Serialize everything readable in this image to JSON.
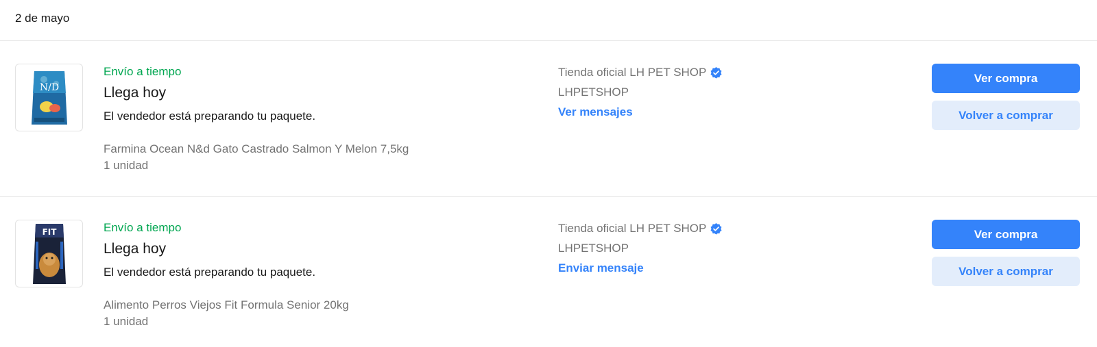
{
  "date_header": "2 de mayo",
  "colors": {
    "accent": "#3483fa",
    "success": "#00a650",
    "muted": "#737373",
    "secondary_bg": "#e3edfb"
  },
  "orders": [
    {
      "status": "Envío a tiempo",
      "headline": "Llega hoy",
      "description": "El vendedor está preparando tu paquete.",
      "product": "Farmina Ocean N&d Gato Castrado Salmon Y Melon 7,5kg",
      "quantity": "1 unidad",
      "seller_official": "Tienda oficial LH PET SHOP",
      "seller_nick": "LHPETSHOP",
      "seller_link": "Ver mensajes",
      "primary_button": "Ver compra",
      "secondary_button": "Volver a comprar",
      "thumb_icon": "cat-food-bag-icon"
    },
    {
      "status": "Envío a tiempo",
      "headline": "Llega hoy",
      "description": "El vendedor está preparando tu paquete.",
      "product": "Alimento Perros Viejos Fit Formula Senior 20kg",
      "quantity": "1 unidad",
      "seller_official": "Tienda oficial LH PET SHOP",
      "seller_nick": "LHPETSHOP",
      "seller_link": "Enviar mensaje",
      "primary_button": "Ver compra",
      "secondary_button": "Volver a comprar",
      "thumb_icon": "dog-food-bag-icon"
    }
  ]
}
